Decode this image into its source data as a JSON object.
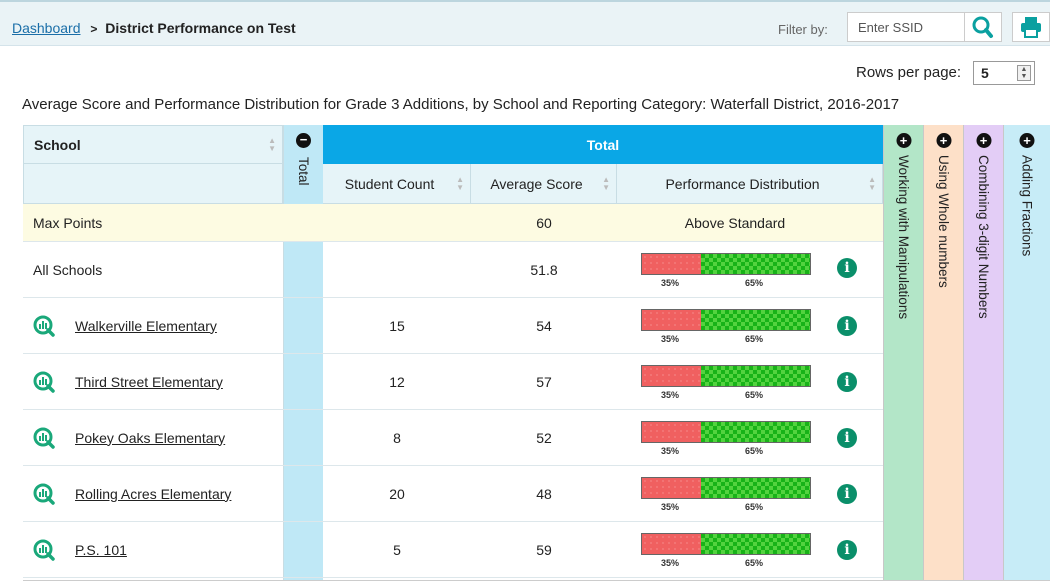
{
  "breadcrumb": {
    "home": "Dashboard",
    "separator": ">",
    "current": "District Performance on Test"
  },
  "filter": {
    "label": "Filter by:",
    "placeholder": "Enter SSID",
    "search_icon": "magnifier-icon",
    "print_icon": "printer-icon"
  },
  "pagination": {
    "rows_label": "Rows per page:",
    "rows_value": "5"
  },
  "report_title": "Average Score and Performance Distribution for Grade 3 Additions, by School and Reporting Category: Waterfall District, 2016-2017",
  "table": {
    "school_header": "School",
    "total_collapsed_label": "Total",
    "total_banner": "Total",
    "col_student_count": "Student Count",
    "col_average_score": "Average Score",
    "col_performance": "Performance Distribution",
    "max_points_label": "Max Points",
    "max_points_score": "60",
    "max_points_perf": "Above Standard",
    "all_schools_label": "All Schools",
    "all_schools_score": "51.8",
    "all_schools_dist": {
      "below": 35,
      "above": 65,
      "below_label": "35%",
      "above_label": "65%"
    },
    "rows": [
      {
        "school": "Walkerville Elementary",
        "count": "15",
        "score": "54",
        "below": 35,
        "above": 65,
        "below_label": "35%",
        "above_label": "65%"
      },
      {
        "school": "Third Street Elementary",
        "count": "12",
        "score": "57",
        "below": 35,
        "above": 65,
        "below_label": "35%",
        "above_label": "65%"
      },
      {
        "school": "Pokey Oaks Elementary",
        "count": "8",
        "score": "52",
        "below": 35,
        "above": 65,
        "below_label": "35%",
        "above_label": "65%"
      },
      {
        "school": "Rolling Acres Elementary",
        "count": "20",
        "score": "48",
        "below": 35,
        "above": 65,
        "below_label": "35%",
        "above_label": "65%"
      },
      {
        "school": "P.S. 101",
        "count": "5",
        "score": "59",
        "below": 35,
        "above": 65,
        "below_label": "35%",
        "above_label": "65%"
      }
    ],
    "collapsed_categories": [
      {
        "label": "Working with Manipulations",
        "color": "#b3e6c8"
      },
      {
        "label": "Using Whole numbers",
        "color": "#fde0c8"
      },
      {
        "label": "Combining 3-digit Numbers",
        "color": "#e3cdf6"
      },
      {
        "label": "Adding Fractions",
        "color": "#c7ecf7"
      }
    ]
  },
  "colors": {
    "accent_blue": "#0aa7e6",
    "below_standard": "#f06060",
    "above_standard": "#18b318",
    "info_green": "#0a8f6a"
  }
}
